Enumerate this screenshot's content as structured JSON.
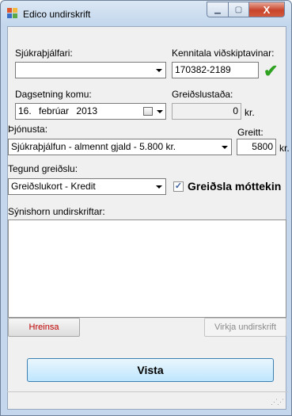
{
  "window": {
    "title": "Edico undirskrift",
    "controls": {
      "minimize": "▁",
      "maximize": "▢",
      "close": "X"
    }
  },
  "form": {
    "therapist_label": "Sjúkraþjálfari:",
    "therapist_value": "",
    "ssn_label": "Kennitala viðskiptavinar:",
    "ssn_value": "170382-2189",
    "ssn_valid_icon": "check-icon",
    "date_label": "Dagsetning komu:",
    "date_day": "16.",
    "date_month": "febrúar",
    "date_year": "2013",
    "status_label": "Greiðslustaða:",
    "status_value": "0",
    "status_unit": "kr.",
    "service_label": "Þjónusta:",
    "service_value": "Sjúkraþjálfun - almennt gjald - 5.800 kr.",
    "paid_label": "Greitt:",
    "paid_value": "5800",
    "paid_unit": "kr.",
    "payment_type_label": "Tegund greiðslu:",
    "payment_type_value": "Greiðslukort - Kredit",
    "payment_received_label": "Greiðsla móttekin",
    "payment_received_checked": true,
    "signature_label": "Sýnishorn undirskriftar:",
    "clear_button": "Hreinsa",
    "activate_button": "Virkja undirskrift",
    "show_button": "Vista"
  },
  "colors": {
    "valid_check": "#2fa321",
    "clear_text": "#c00000",
    "disabled_text": "#8a8a8a"
  }
}
